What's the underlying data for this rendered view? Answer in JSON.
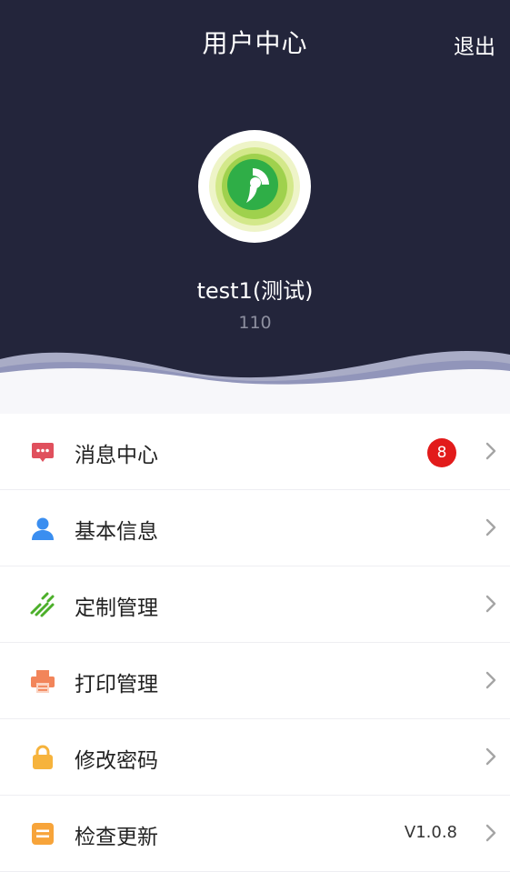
{
  "header": {
    "title": "用户中心",
    "logout_label": "退出",
    "user_name": "test1(测试)",
    "user_code": "110"
  },
  "menu": [
    {
      "label": "消息中心",
      "icon": "message-icon",
      "badge": "8"
    },
    {
      "label": "基本信息",
      "icon": "user-icon"
    },
    {
      "label": "定制管理",
      "icon": "customize-icon"
    },
    {
      "label": "打印管理",
      "icon": "printer-icon"
    },
    {
      "label": "修改密码",
      "icon": "lock-icon"
    },
    {
      "label": "检查更新",
      "icon": "update-icon",
      "value": "V1.0.8"
    }
  ],
  "colors": {
    "header_bg": "#23253b",
    "badge": "#e21b1b",
    "message_icon": "#e0505d",
    "user_icon": "#3a8ef0",
    "customize_icon": "#4caf2a",
    "printer_icon": "#f2855a",
    "lock_icon": "#f6b33c",
    "update_icon": "#f7a43a"
  }
}
